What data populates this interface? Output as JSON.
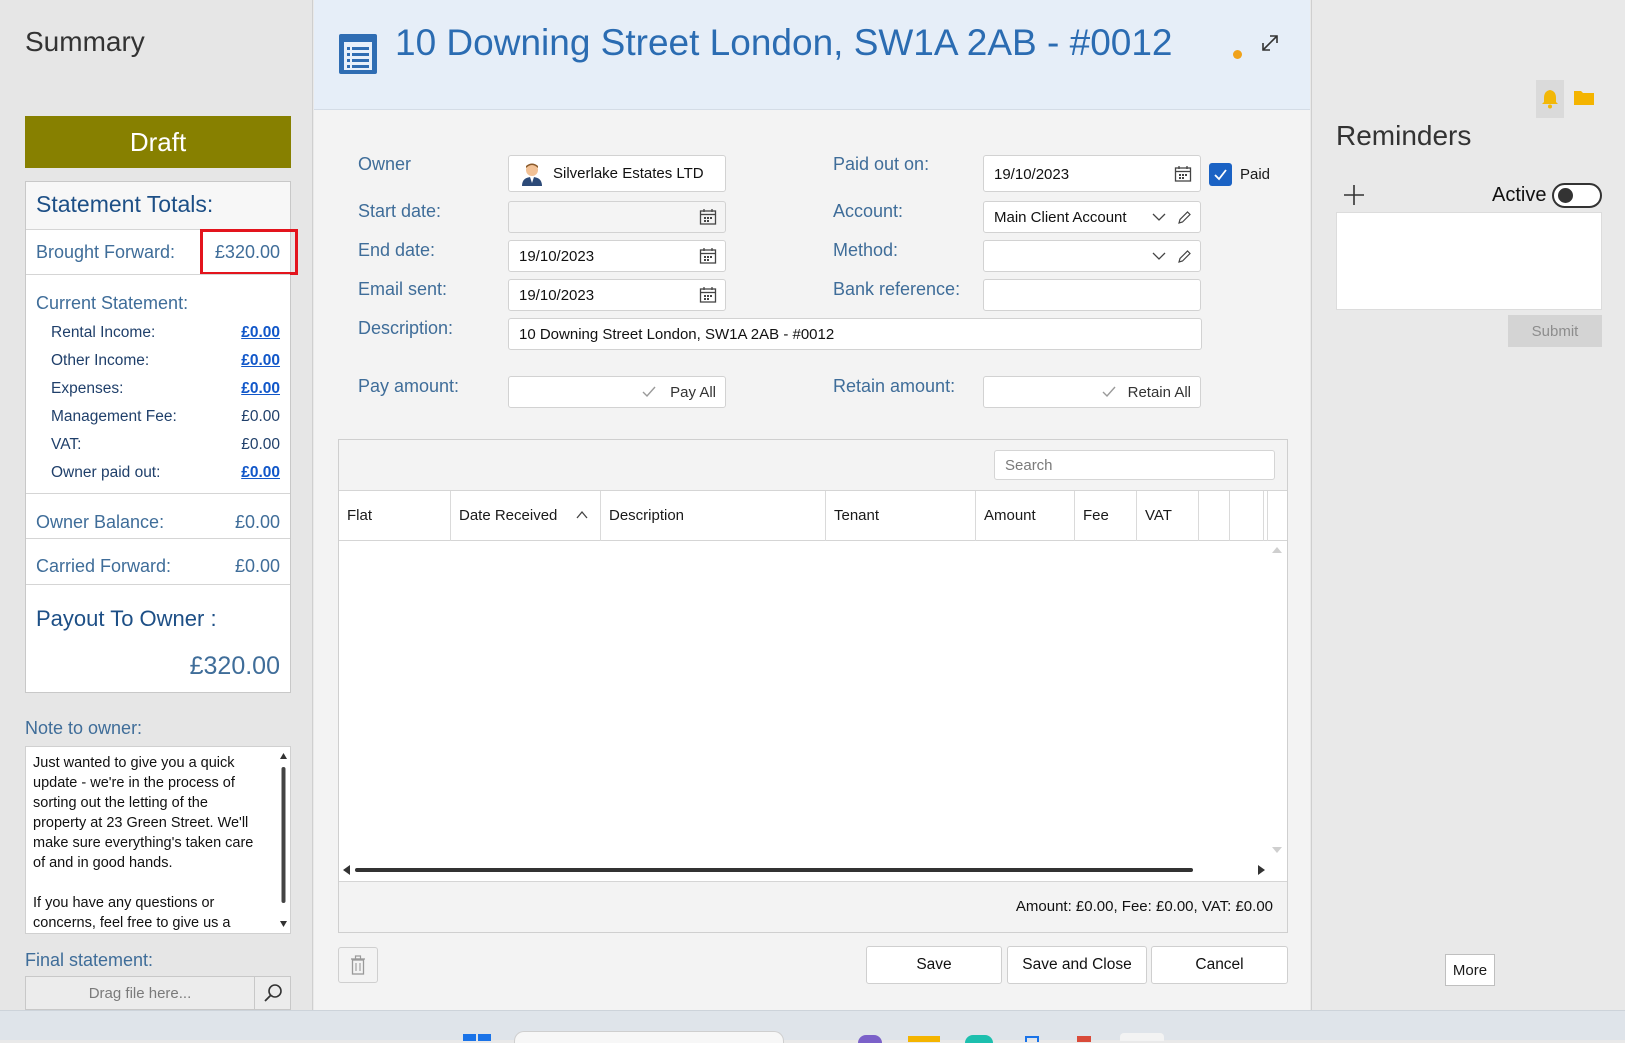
{
  "summary": {
    "title": "Summary",
    "status": "Draft",
    "totals_header": "Statement Totals:",
    "brought_forward_label": "Brought Forward:",
    "brought_forward_value": "£320.00",
    "current_statement_label": "Current Statement:",
    "lines": [
      {
        "label": "Rental Income:",
        "value": "£0.00",
        "link": true
      },
      {
        "label": "Other Income:",
        "value": "£0.00",
        "link": true
      },
      {
        "label": "Expenses:",
        "value": "£0.00",
        "link": true
      },
      {
        "label": "Management Fee:",
        "value": "£0.00",
        "link": false
      },
      {
        "label": "VAT:",
        "value": "£0.00",
        "link": false
      },
      {
        "label": "Owner paid out:",
        "value": "£0.00",
        "link": true
      }
    ],
    "owner_balance_label": "Owner Balance:",
    "owner_balance_value": "£0.00",
    "carried_forward_label": "Carried Forward:",
    "carried_forward_value": "£0.00",
    "payout_label": "Payout To Owner :",
    "payout_value": "£320.00",
    "note_label": "Note to owner:",
    "note_text": "Just wanted to give you a quick update - we're in the process of sorting out the letting of the property at 23 Green Street. We'll make sure everything's taken care of and in good hands.\n\nIf you have any questions or concerns, feel free to give us a",
    "final_statement_label": "Final statement:",
    "drag_placeholder": "Drag file here..."
  },
  "header": {
    "title": "10 Downing Street London, SW1A 2AB - #0012"
  },
  "form": {
    "owner_label": "Owner",
    "owner_value": "Silverlake Estates LTD",
    "start_date_label": "Start date:",
    "start_date_value": "",
    "end_date_label": "End date:",
    "end_date_value": "19/10/2023",
    "email_sent_label": "Email sent:",
    "email_sent_value": "19/10/2023",
    "description_label": "Description:",
    "description_value": "10 Downing Street London, SW1A 2AB - #0012",
    "pay_amount_label": "Pay amount:",
    "pay_all_label": "Pay All",
    "paid_out_label": "Paid out on:",
    "paid_out_value": "19/10/2023",
    "paid_label": "Paid",
    "paid_checked": true,
    "account_label": "Account:",
    "account_value": "Main Client Account",
    "method_label": "Method:",
    "method_value": "",
    "bank_ref_label": "Bank reference:",
    "bank_ref_value": "",
    "retain_amount_label": "Retain amount:",
    "retain_all_label": "Retain All"
  },
  "grid": {
    "search_placeholder": "Search",
    "columns": [
      "Flat",
      "Date Received",
      "Description",
      "Tenant",
      "Amount",
      "Fee",
      "VAT",
      "",
      ""
    ],
    "rows": [],
    "footer": "Amount: £0.00, Fee: £0.00, VAT: £0.00"
  },
  "actions": {
    "save": "Save",
    "save_close": "Save and Close",
    "cancel": "Cancel"
  },
  "reminders": {
    "title": "Reminders",
    "active_label": "Active",
    "active_on": false,
    "submit": "Submit",
    "more": "More"
  },
  "colors": {
    "draft": "#878000",
    "accent": "#2b6cb2",
    "highlight": "#e3141d",
    "status_dot": "#f0a21b"
  }
}
